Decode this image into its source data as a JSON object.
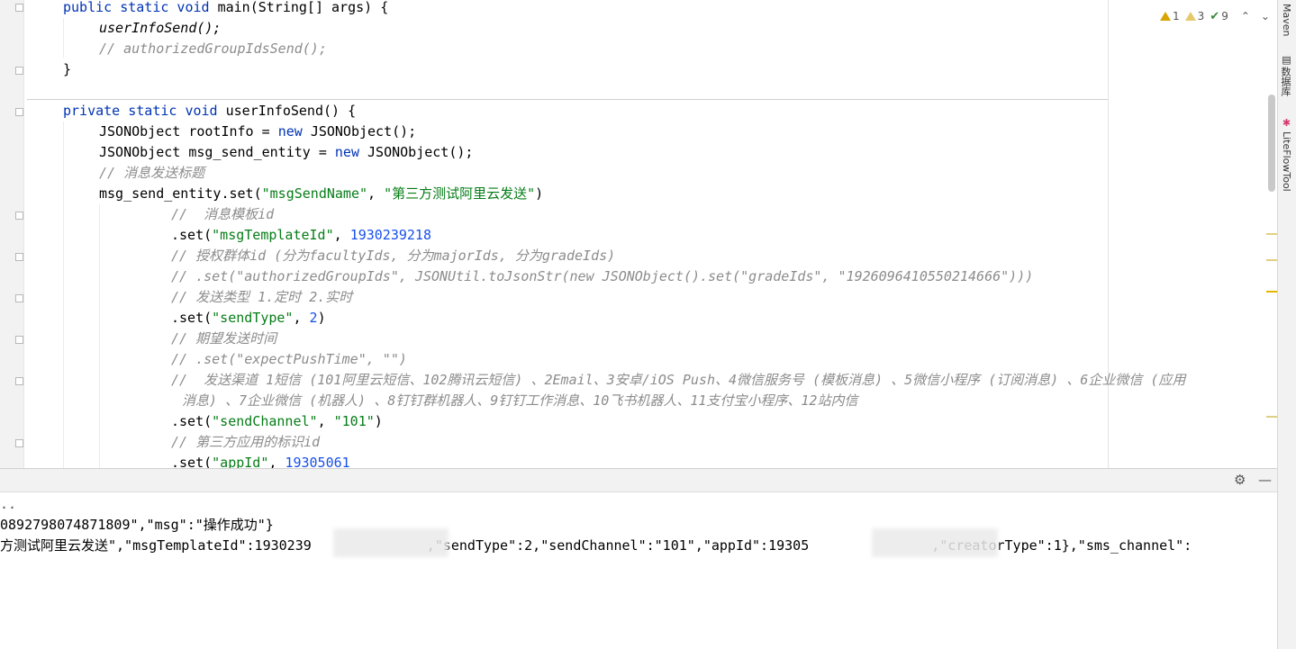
{
  "inspections": {
    "warnings": "1",
    "weak_warnings": "3",
    "typos": "9"
  },
  "right_tabs": {
    "maven": "Maven",
    "database": "数据库",
    "liteflow": "LiteFlowTool"
  },
  "code": {
    "l1_a": "public static void",
    "l1_b": "main(String[] args) {",
    "l2": "userInfoSend();",
    "l3": "// authorizedGroupIdsSend();",
    "l4": "}",
    "l5_a": "private static void",
    "l5_b": "userInfoSend() {",
    "l6_a": "JSONObject rootInfo =",
    "l6_b": "new",
    "l6_c": "JSONObject();",
    "l7_a": "JSONObject msg_send_entity =",
    "l7_b": "new",
    "l7_c": "JSONObject();",
    "l8": "// 消息发送标题",
    "l9_a": "msg_send_entity.set(",
    "l9_b": "\"msgSendName\"",
    "l9_c": ",",
    "l9_d": "\"第三方测试阿里云发送\"",
    "l9_e": ")",
    "l10": "//  消息模板id",
    "l11_a": ".set(",
    "l11_b": "\"msgTemplateId\"",
    "l11_c": ",",
    "l11_d": "1930239218",
    "l12": "// 授权群体id (分为facultyIds, 分为majorIds, 分为gradeIds)",
    "l13": "// .set(\"authorizedGroupIds\", JSONUtil.toJsonStr(new JSONObject().set(\"gradeIds\", \"1926096410550214666\")))",
    "l14": "// 发送类型 1.定时 2.实时",
    "l15_a": ".set(",
    "l15_b": "\"sendType\"",
    "l15_c": ",",
    "l15_d": "2",
    "l15_e": ")",
    "l16": "// 期望发送时间",
    "l17": "// .set(\"expectPushTime\", \"\")",
    "l18": "//  发送渠道 1短信 (101阿里云短信、102腾讯云短信) 、2Email、3安卓/iOS Push、4微信服务号 (模板消息) 、5微信小程序 (订阅消息) 、6企业微信 (应用",
    "l19": "消息) 、7企业微信 (机器人) 、8钉钉群机器人、9钉钉工作消息、10飞书机器人、11支付宝小程序、12站内信",
    "l20_a": ".set(",
    "l20_b": "\"sendChannel\"",
    "l20_c": ",",
    "l20_d": "\"101\"",
    "l20_e": ")",
    "l21": "// 第三方应用的标识id",
    "l22_a": ".set(",
    "l22_b": "\"appId\"",
    "l22_c": ",",
    "l22_d": "19305061"
  },
  "console": {
    "line1": "..",
    "line2": "0892798074871809\",\"msg\":\"操作成功\"}",
    "line3_a": "方测试阿里云发送\",\"msgTemplateId\":1930239",
    "line3_b": ",\"sendType\":2,\"sendChannel\":\"101\",\"appId\":19305",
    "line3_c": ",\"creatorType\":1},\"sms_channel\":"
  }
}
